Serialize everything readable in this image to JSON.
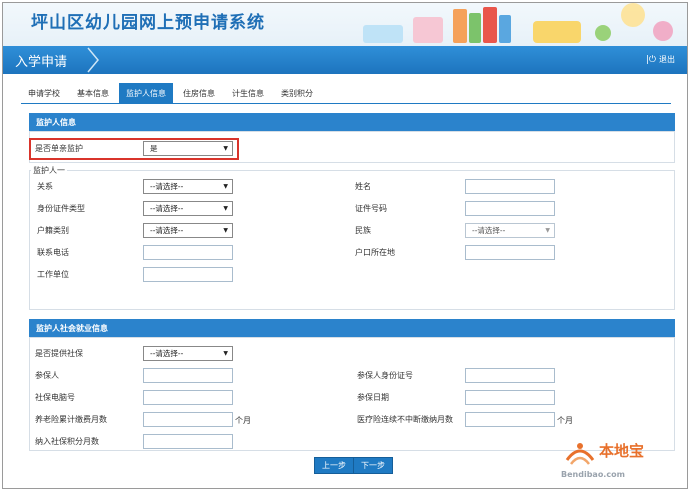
{
  "banner": {
    "title": "坪山区幼儿园网上预申请系统"
  },
  "nav": {
    "title": "入学申请",
    "logout_label": "退出"
  },
  "tabs": [
    "申请学校",
    "基本信息",
    "监护人信息",
    "住房信息",
    "计生信息",
    "类别积分"
  ],
  "active_tab": "监护人信息",
  "guardian": {
    "section_title": "监护人信息",
    "single_parent_label": "是否单亲监护",
    "single_parent_value": "是",
    "group_title": "监护人一",
    "relation_label": "关系",
    "relation_value": "--请选择--",
    "name_label": "姓名",
    "id_type_label": "身份证件类型",
    "id_type_value": "--请选择--",
    "id_number_label": "证件号码",
    "hukou_type_label": "户籍类别",
    "hukou_type_value": "--请选择--",
    "ethnicity_label": "民族",
    "ethnicity_value": "--请选择--",
    "phone_label": "联系电话",
    "hukou_location_label": "户口所在地",
    "employer_label": "工作单位"
  },
  "social": {
    "section_title": "监护人社会就业信息",
    "provide_label": "是否提供社保",
    "provide_value": "--请选择--",
    "insured_label": "参保人",
    "insured_id_label": "参保人身份证号",
    "computer_no_label": "社保电脑号",
    "insured_date_label": "参保日期",
    "pension_months_label": "养老险累计缴费月数",
    "medical_months_label": "医疗险连续不中断缴纳月数",
    "month_unit": "个月",
    "points_months_label": "纳入社保积分月数"
  },
  "buttons": {
    "prev": "上一步",
    "next": "下一步"
  },
  "watermark": {
    "brand": "本地宝",
    "url": "Bendibao.com"
  },
  "colors": {
    "primary": "#1f7ac3",
    "highlight": "#d9342b",
    "watermark": "#e8712c"
  }
}
